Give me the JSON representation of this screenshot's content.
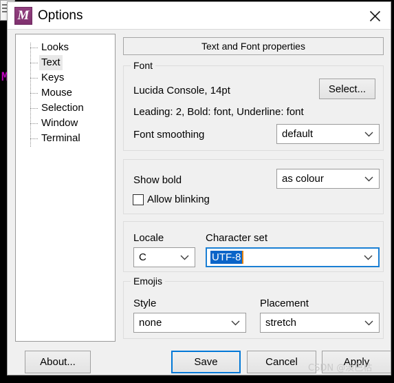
{
  "window": {
    "title": "Options",
    "icon": "mintty-m-icon",
    "close_label": "✕",
    "icon_letter": "M"
  },
  "sidebar": {
    "items": [
      {
        "label": "Looks",
        "selected": false
      },
      {
        "label": "Text",
        "selected": true
      },
      {
        "label": "Keys",
        "selected": false
      },
      {
        "label": "Mouse",
        "selected": false
      },
      {
        "label": "Selection",
        "selected": false
      },
      {
        "label": "Window",
        "selected": false
      },
      {
        "label": "Terminal",
        "selected": false
      }
    ]
  },
  "main": {
    "tab_header": "Text and Font properties",
    "font_group": {
      "title": "Font",
      "font_description": "Lucida Console, 14pt",
      "font_attributes": "Leading: 2, Bold: font, Underline: font",
      "select_button": "Select...",
      "smoothing_label": "Font smoothing",
      "smoothing_value": "default"
    },
    "bold_group": {
      "show_bold_label": "Show bold",
      "show_bold_value": "as colour",
      "allow_blinking_label": "Allow blinking",
      "allow_blinking_checked": false
    },
    "locale_group": {
      "locale_label": "Locale",
      "locale_value": "C",
      "charset_label": "Character set",
      "charset_value": "UTF-8",
      "charset_focused": true
    },
    "emoji_group": {
      "title": "Emojis",
      "style_label": "Style",
      "style_value": "none",
      "placement_label": "Placement",
      "placement_value": "stretch"
    }
  },
  "footer": {
    "about": "About...",
    "save": "Save",
    "cancel": "Cancel",
    "apply": "Apply"
  },
  "watermark": "CSDN @淡巴枯",
  "colors": {
    "accent": "#0078d7",
    "selection": "#0a64c8",
    "caret": "#e8820c",
    "icon_purple": "#8e3a7e",
    "dialog_bg": "#f0f0f0"
  }
}
